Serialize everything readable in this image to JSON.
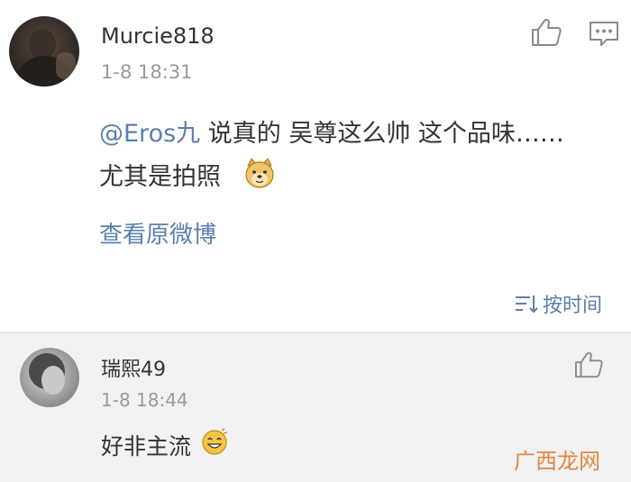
{
  "main_comment": {
    "username": "Murcie818",
    "timestamp": "1-8 18:31",
    "mention": "@Eros九",
    "text_line1": " 说真的 吴尊这么帅 这个品味……",
    "text_line2": "尤其是拍照",
    "emoji": "doge-emoji",
    "view_original_label": "查看原微博",
    "like_icon": "thumbs-up-icon",
    "reply_icon": "comment-icon"
  },
  "sort": {
    "label": "按时间",
    "icon": "sort-icon"
  },
  "reply": {
    "username": "瑞熙49",
    "timestamp": "1-8 18:44",
    "text": "好非主流",
    "emoji": "grin-emoji",
    "like_icon": "thumbs-up-icon"
  },
  "watermark": {
    "text": "广西龙网"
  },
  "colors": {
    "link": "#5b7fae",
    "text": "#333333",
    "muted": "#9a9a9a",
    "reply_background": "#f2f2f2",
    "watermark": "#e27b2e"
  }
}
